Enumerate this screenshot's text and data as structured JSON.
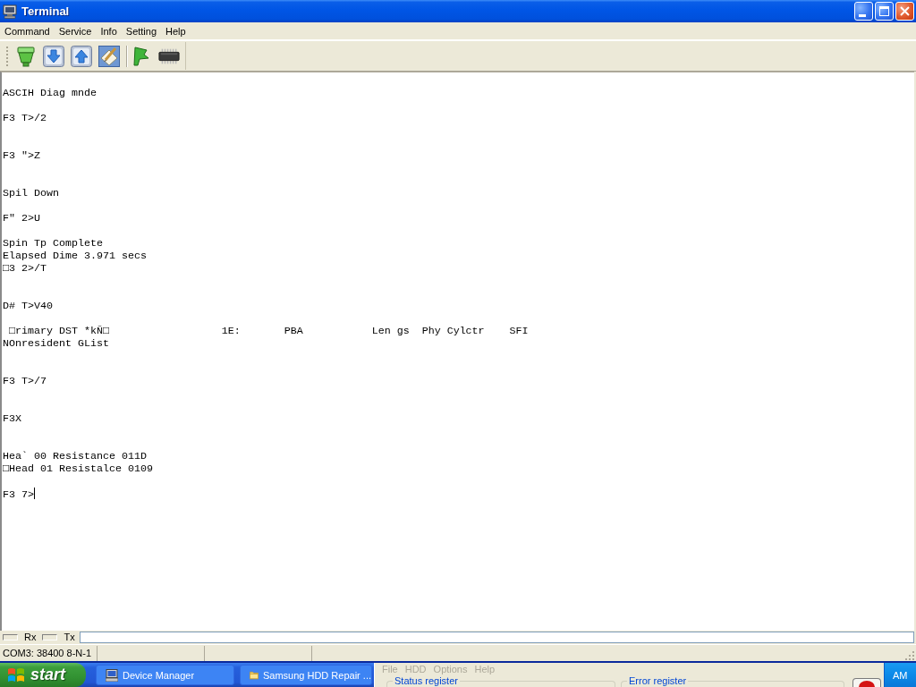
{
  "window": {
    "title": "Terminal"
  },
  "menu": [
    "Command",
    "Service",
    "Info",
    "Setting",
    "Help"
  ],
  "terminal": {
    "output": "ASCIH Diag mnde\n\nF3 T>/2\n\n\nF3 \">Z\n\n\nSpil Down\n\nF\" 2>U\n\nSpin Tp Complete\nElapsed Dime 3.971 secs\n□3 2>/T\n\n\nD# T>V40\n\n □rimary DST *kÑ□                  1E:       PBA           Len gs  Phy Cylctr    SFI\nNOnresident GList\n\n\nF3 T>/7\n\n\nF3X\n\n\nHea` 00 Resistance 011D\n□Head 01 Resistalce 0109\n\nF3 7>",
    "cursor": true
  },
  "io_bar": {
    "indicators": [
      {
        "label": "Rx",
        "lit": false
      },
      {
        "label": "Tx",
        "lit": false
      }
    ]
  },
  "status_bar": {
    "panes": [
      "COM3: 38400 8-N-1"
    ]
  },
  "taskbar": {
    "start": "start",
    "tasks": [
      {
        "label": "Device Manager",
        "kind": "computer",
        "selected": false
      },
      {
        "label": "Samsung HDD Repair ...",
        "kind": "folder",
        "selected": false
      }
    ],
    "clock": "AM"
  },
  "background_window": {
    "menu": [
      {
        "label": "File",
        "disabled": true
      },
      {
        "label": "HDD",
        "disabled": true
      },
      {
        "label": "Options",
        "disabled": true
      },
      {
        "label": "Help",
        "disabled": true
      }
    ],
    "groups": [
      "Status register",
      "Error register"
    ]
  }
}
